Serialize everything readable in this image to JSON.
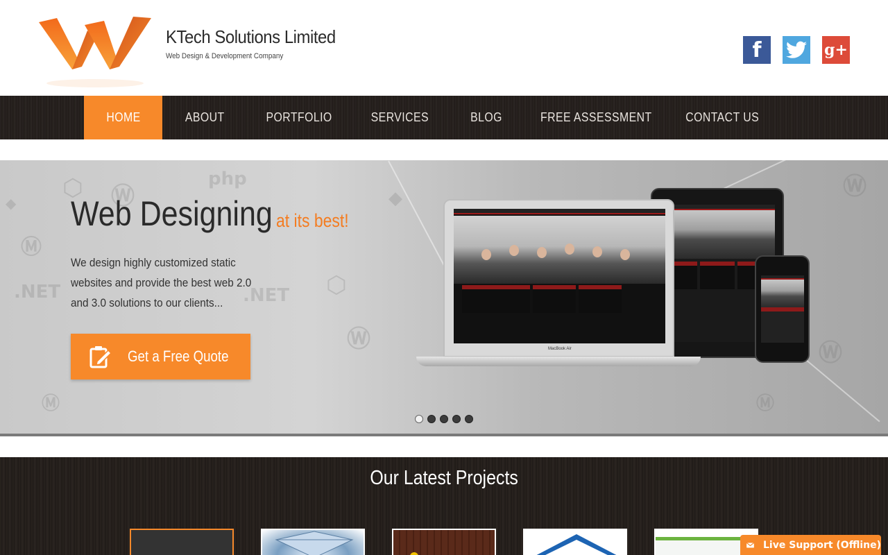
{
  "header": {
    "brand_title": "KTech Solutions Limited",
    "brand_tagline": "Web Design & Development Company",
    "social": [
      {
        "name": "facebook-icon",
        "glyph": "f"
      },
      {
        "name": "twitter-icon",
        "glyph": "t"
      },
      {
        "name": "google-plus-icon",
        "glyph": "g+"
      }
    ]
  },
  "nav": {
    "items": [
      "HOME",
      "ABOUT",
      "PORTFOLIO",
      "SERVICES",
      "BLOG",
      "FREE ASSESSMENT",
      "CONTACT US"
    ],
    "active": "HOME"
  },
  "hero": {
    "title": "Web Designing",
    "title_accent": "at its best!",
    "description": "We design highly customized static websites and provide the best web 2.0 and 3.0 solutions to our clients...",
    "cta_label": "Get a Free Quote",
    "device_label": "MacBook Air",
    "slides": 5,
    "active_slide": 1
  },
  "projects": {
    "title": "Our Latest Projects"
  },
  "live_support": {
    "label": "Live Support (Offline)"
  },
  "colors": {
    "accent": "#f7892a",
    "accent_text": "#f47c20",
    "nav_bg": "#241f1c",
    "facebook": "#3b5998",
    "twitter": "#4fa7df",
    "google_plus": "#dd4b39"
  }
}
